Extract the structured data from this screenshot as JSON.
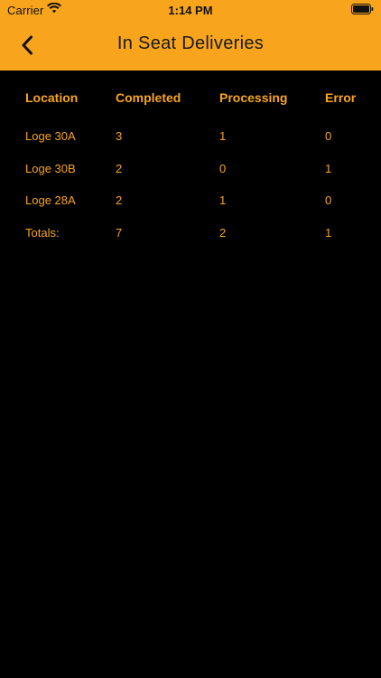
{
  "colors": {
    "accent": "#F8A51D",
    "background": "#000000",
    "title_text": "#1A1A1A"
  },
  "status_bar": {
    "carrier": "Carrier",
    "time": "1:14 PM",
    "wifi_icon": "wifi-icon",
    "battery_icon": "battery-icon"
  },
  "nav": {
    "back_icon": "chevron-left-icon",
    "title": "In Seat Deliveries"
  },
  "table": {
    "headers": [
      "Location",
      "Completed",
      "Processing",
      "Error"
    ],
    "rows": [
      [
        "Loge 30A",
        "3",
        "1",
        "0"
      ],
      [
        "Loge 30B",
        "2",
        "0",
        "1"
      ],
      [
        "Loge 28A",
        "2",
        "1",
        "0"
      ],
      [
        "Totals:",
        "7",
        "2",
        "1"
      ]
    ]
  }
}
